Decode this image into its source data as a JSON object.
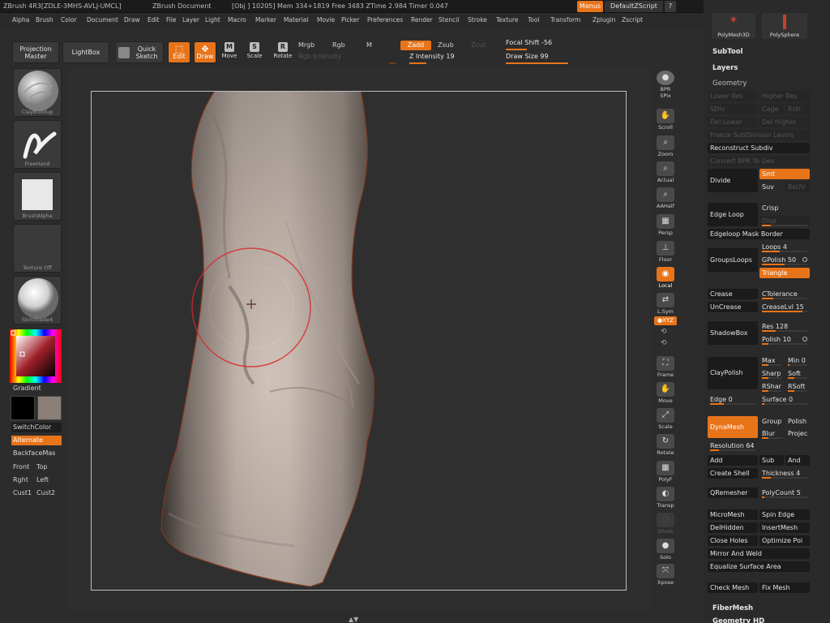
{
  "titlebar": {
    "app": "ZBrush 4R3[ZDLE-3MHS-AVLJ-UMCL]",
    "document": "ZBrush Document",
    "stats": "[Obj ] 10205] Mem 334+1819 Free 3483 ZTime 2.984 Timer 0.047",
    "menus": "Menus",
    "script": "DefaultZScript"
  },
  "menubar": [
    "Alpha",
    "Brush",
    "Color",
    "Document",
    "Draw",
    "Edit",
    "File",
    "Layer",
    "Light",
    "Macro",
    "Marker",
    "Material",
    "Movie",
    "Picker",
    "Preferences",
    "Render",
    "Stencil",
    "Stroke",
    "Texture",
    "Tool",
    "Transform",
    "Zplugin",
    "Zscript"
  ],
  "toolbar": {
    "projection_master": "Projection Master",
    "lightbox": "LightBox",
    "quick_sketch": "Quick Sketch",
    "edit": "Edit",
    "draw": "Draw",
    "move": "Move",
    "scale": "Scale",
    "rotate": "Rotate",
    "mrgb": "Mrgb",
    "rgb": "Rgb",
    "m": "M",
    "rgb_intensity": "Rgb Intensity",
    "zadd": "Zadd",
    "zsub": "Zsub",
    "zcut": "Zcut",
    "z_intensity": "Z Intensity 19",
    "focal_shift": "Focal Shift -56",
    "draw_size": "Draw Size 99",
    "z_intensity_level": 19,
    "focal_shift_level": -56,
    "draw_size_level": 99
  },
  "left_shelf": {
    "brush": "ClayBuildup",
    "stroke": "FreeHand",
    "alpha": "BrushAlpha",
    "texture": "Texture Off",
    "material": "SkinShade4",
    "gradient": "Gradient",
    "switch_color": "SwitchColor",
    "alternate": "Alternate",
    "backface": "BackfaceMas",
    "front": "Front",
    "top": "Top",
    "right": "Rght",
    "left": "Left",
    "cust1": "Cust1",
    "cust2": "Cust2"
  },
  "right_shelf": {
    "bpr": "BPR",
    "spix": "SPix",
    "scroll": "Scroll",
    "zoom": "Zoom",
    "actual": "Actual",
    "aahalf": "AAHalf",
    "persp": "Persp",
    "floor": "Floor",
    "local": "Local",
    "lsym": "L.Sym",
    "xyz": "●XYZ",
    "frame": "Frame",
    "move": "Move",
    "scale": "Scale",
    "rotate": "Rotate",
    "polyf": "PolyF",
    "transp": "Transp",
    "ghost": "Ghost",
    "solo": "Solo",
    "xpose": "Xpose"
  },
  "tool_panel": {
    "polymesh3d": "PolyMesh3D",
    "polysphere": "PolySphere",
    "subtool": "SubTool",
    "layers": "Layers",
    "geometry": "Geometry",
    "lower_res": "Lower Res",
    "higher_res": "Higher Res",
    "sdiv": "SDiv",
    "cage": "Cage",
    "rstr": "Rstr",
    "del_lower": "Del Lower",
    "del_higher": "Del Higher",
    "freeze_subdiv": "Freeze SubDivision Levels",
    "reconstruct_subdiv": "Reconstruct Subdiv",
    "convert_bpr": "Convert BPR To Geo",
    "divide": "Divide",
    "smt": "Smt",
    "suv": "Suv",
    "reuv": "ReUV",
    "edge_loop": "Edge Loop",
    "crisp": "Crisp",
    "disp": "Disp",
    "edgeloop_mask_border": "Edgeloop Mask Border",
    "loops": "Loops 4",
    "groups_loops": "GroupsLoops",
    "gpolish": "GPolish 50",
    "triangle": "Triangle",
    "crease": "Crease",
    "ctolerance": "CTolerance",
    "uncrease": "UnCrease",
    "creaselvl": "CreaseLvl 15",
    "res": "Res 128",
    "shadowbox": "ShadowBox",
    "polish": "Polish 10",
    "max": "Max",
    "min": "Min 0",
    "claypolish": "ClayPolish",
    "sharp": "Sharp",
    "soft": "Soft",
    "rshar": "RShar",
    "rsoft": "RSoft",
    "edge": "Edge 0",
    "surface": "Surface 0",
    "dynamesh": "DynaMesh",
    "group": "Group",
    "polish2": "Polish",
    "blur": "Blur",
    "projec": "Projec",
    "resolution": "Resolution 64",
    "add": "Add",
    "sub": "Sub",
    "and": "And",
    "create_shell": "Create Shell",
    "thickness": "Thickness 4",
    "qremesher": "QRemesher",
    "polycount": "PolyCount 5",
    "micromesh": "MicroMesh",
    "spin_edge": "Spin Edge",
    "delhidden": "DelHidden",
    "insertmesh": "InsertMesh",
    "close_holes": "Close Holes",
    "optimize_poi": "Optimize Poi",
    "mirror_weld": "Mirror And Weld",
    "equalize": "Equalize Surface Area",
    "check_mesh": "Check Mesh",
    "fix_mesh": "Fix Mesh",
    "fibermesh": "FiberMesh",
    "geometry_hd": "Geometry HD"
  },
  "colors": {
    "accent": "#e8741a",
    "bg": "#2c2c2c",
    "button": "#1b1b1b",
    "mesh": "#c9b7ab"
  }
}
